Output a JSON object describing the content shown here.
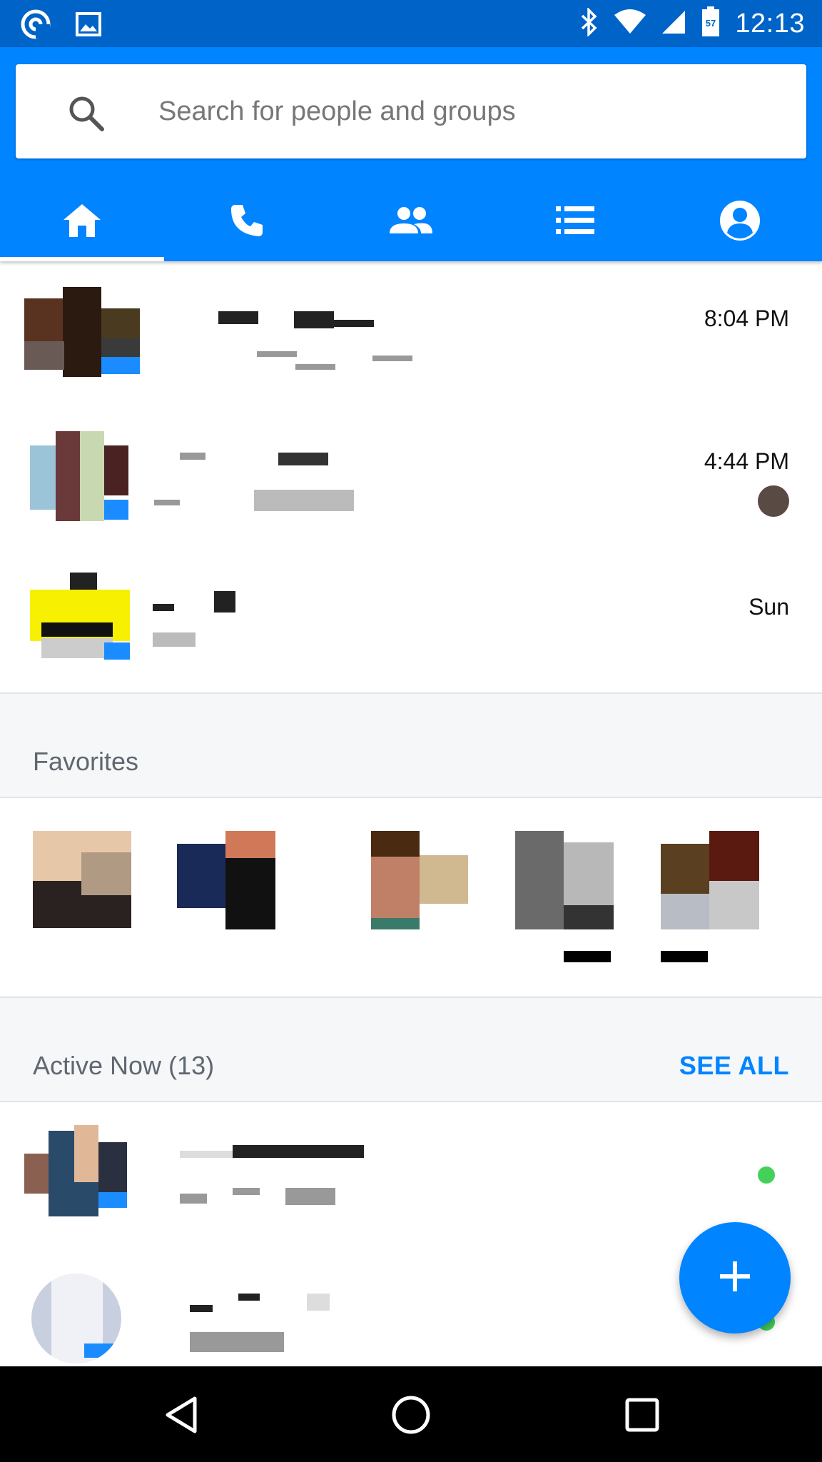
{
  "status_bar": {
    "time": "12:13",
    "icons": [
      "messenger-icon",
      "image-icon",
      "bluetooth-icon",
      "wifi-icon",
      "signal-icon",
      "battery-icon"
    ],
    "battery_level": "57"
  },
  "search": {
    "placeholder": "Search for people and groups"
  },
  "tabs": [
    {
      "icon": "home-icon",
      "active": true
    },
    {
      "icon": "phone-icon",
      "active": false
    },
    {
      "icon": "groups-icon",
      "active": false
    },
    {
      "icon": "list-icon",
      "active": false
    },
    {
      "icon": "profile-icon",
      "active": false
    }
  ],
  "conversations": [
    {
      "time": "8:04 PM"
    },
    {
      "time": "4:44 PM"
    },
    {
      "time": "Sun"
    }
  ],
  "favorites": {
    "title": "Favorites"
  },
  "active_now": {
    "title": "Active Now (13)",
    "see_all": "SEE ALL"
  },
  "colors": {
    "brand": "#0084ff",
    "status_bar": "#0063c8",
    "active_dot": "#44d15a"
  }
}
